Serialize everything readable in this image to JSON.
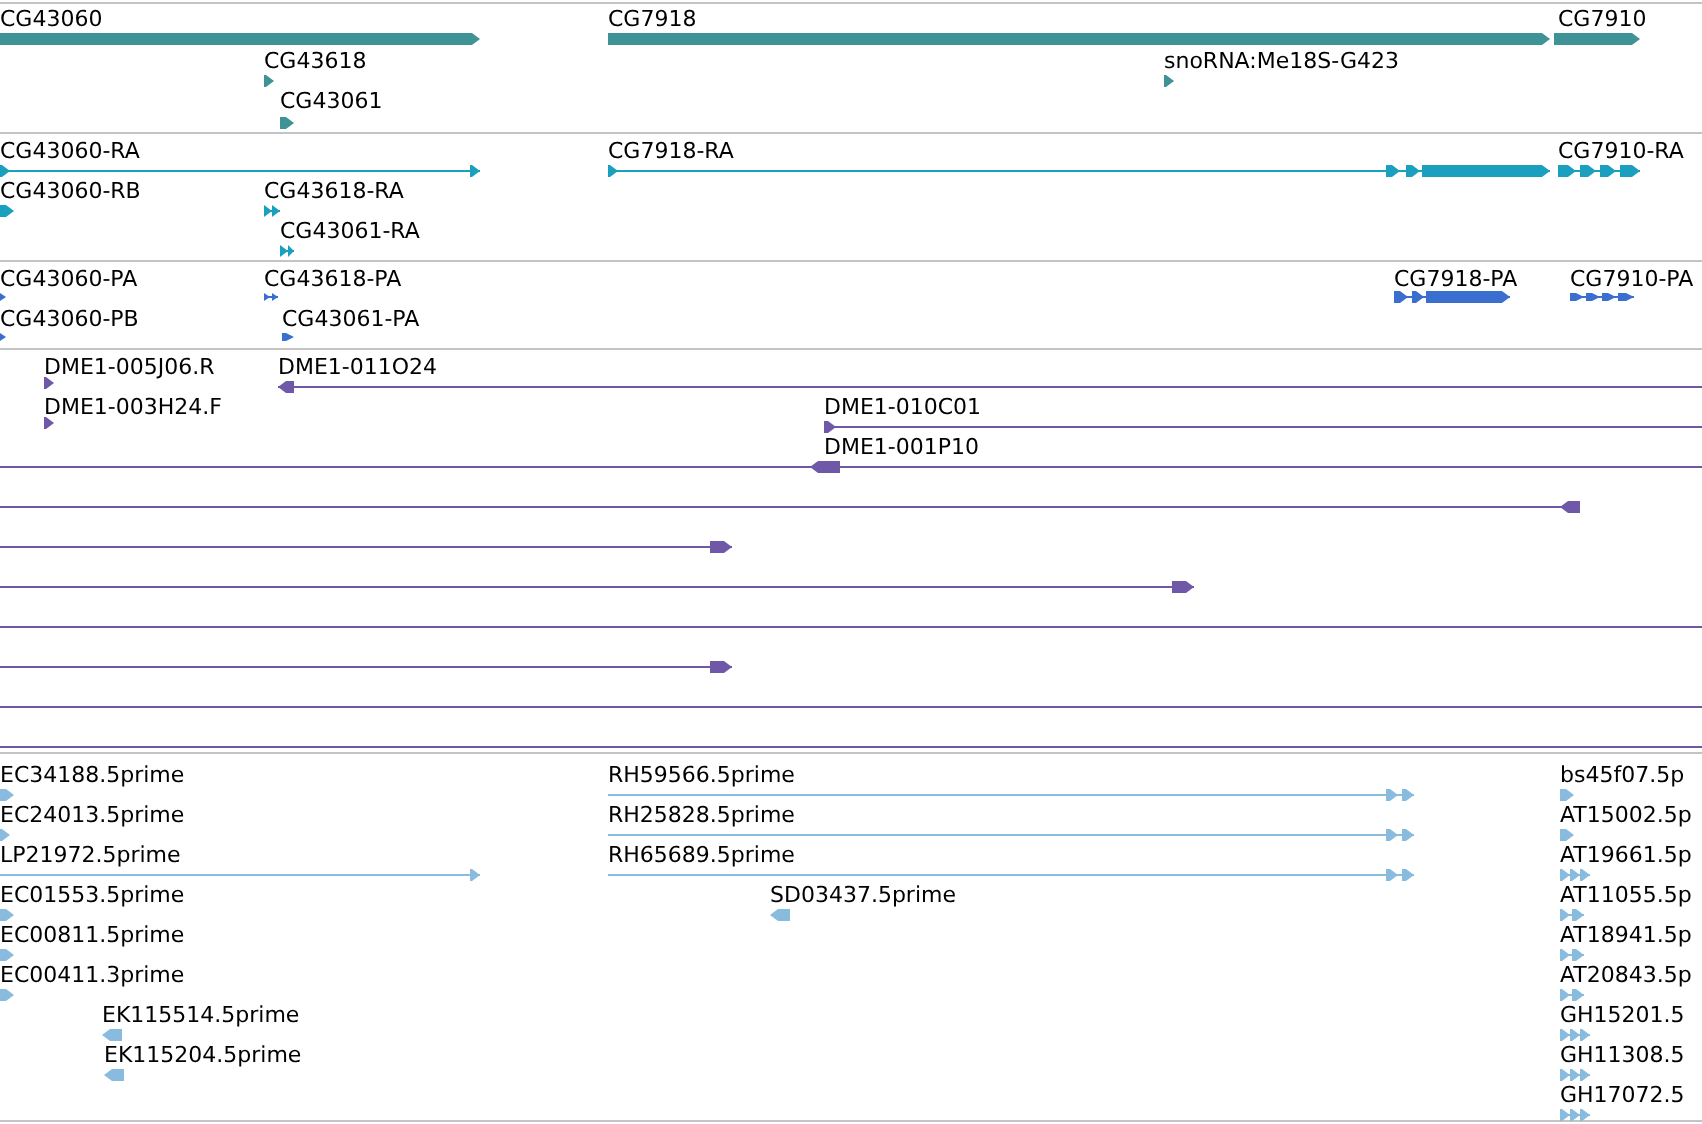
{
  "tracks": [
    {
      "kind": "gene",
      "features": [
        {
          "label": "CG43060",
          "reverse": false
        },
        {
          "label": "CG7918",
          "reverse": false
        },
        {
          "label": "CG7910",
          "reverse": false
        },
        {
          "label": "CG43618",
          "reverse": false
        },
        {
          "label": "snoRNA:Me18S-G423",
          "reverse": false
        },
        {
          "label": "CG43061",
          "reverse": false
        }
      ]
    },
    {
      "kind": "transcript",
      "features": [
        {
          "label": "CG43060-RA",
          "reverse": false
        },
        {
          "label": "CG7918-RA",
          "reverse": false
        },
        {
          "label": "CG7910-RA",
          "reverse": false
        },
        {
          "label": "CG43060-RB",
          "reverse": false
        },
        {
          "label": "CG43618-RA",
          "reverse": false
        },
        {
          "label": "CG43061-RA",
          "reverse": false
        }
      ]
    },
    {
      "kind": "protein",
      "features": [
        {
          "label": "CG43060-PA",
          "reverse": false
        },
        {
          "label": "CG43618-PA",
          "reverse": false
        },
        {
          "label": "CG7918-PA",
          "reverse": false
        },
        {
          "label": "CG7910-PA",
          "reverse": false
        },
        {
          "label": "CG43060-PB",
          "reverse": false
        },
        {
          "label": "CG43061-PA",
          "reverse": false
        }
      ]
    },
    {
      "kind": "clone",
      "features": [
        {
          "label": "DME1-005J06.R",
          "reverse": false
        },
        {
          "label": "DME1-011O24",
          "reverse": true
        },
        {
          "label": "DME1-003H24.F",
          "reverse": false
        },
        {
          "label": "DME1-010C01",
          "reverse": false
        },
        {
          "label": "DME1-001P10",
          "reverse": true
        },
        {
          "reverse": true
        },
        {
          "reverse": false
        },
        {
          "reverse": false
        },
        {
          "reverse": false
        }
      ]
    },
    {
      "kind": "est",
      "features": [
        {
          "label": "EC34188.5prime",
          "reverse": false
        },
        {
          "label": "RH59566.5prime",
          "reverse": false
        },
        {
          "label": "bs45f07.5p",
          "reverse": false
        },
        {
          "label": "EC24013.5prime",
          "reverse": false
        },
        {
          "label": "RH25828.5prime",
          "reverse": false
        },
        {
          "label": "AT15002.5p",
          "reverse": false
        },
        {
          "label": "LP21972.5prime",
          "reverse": false
        },
        {
          "label": "RH65689.5prime",
          "reverse": false
        },
        {
          "label": "AT19661.5p",
          "reverse": false
        },
        {
          "label": "EC01553.5prime",
          "reverse": false
        },
        {
          "label": "SD03437.5prime",
          "reverse": true
        },
        {
          "label": "AT11055.5p",
          "reverse": false
        },
        {
          "label": "EC00811.5prime",
          "reverse": false
        },
        {
          "label": "AT18941.5p",
          "reverse": false
        },
        {
          "label": "EC00411.3prime",
          "reverse": false
        },
        {
          "label": "AT20843.5p",
          "reverse": false
        },
        {
          "label": "EK115514.5prime",
          "reverse": true
        },
        {
          "label": "GH15201.5",
          "reverse": false
        },
        {
          "label": "EK115204.5prime",
          "reverse": true
        },
        {
          "label": "GH11308.5",
          "reverse": false
        },
        {
          "label": "GH17072.5",
          "reverse": false
        }
      ]
    }
  ]
}
